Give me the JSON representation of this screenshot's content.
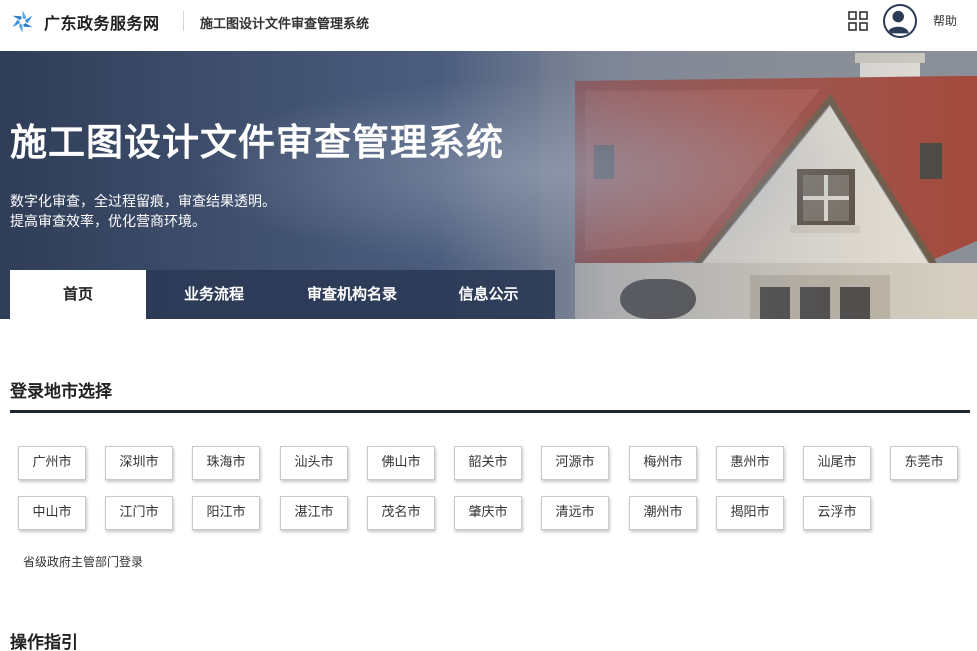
{
  "header": {
    "brand": "广东政务服务网",
    "system_name": "施工图设计文件审查管理系统",
    "help_label": "帮助",
    "icons": {
      "logo": "gd-gov-logo-icon",
      "apps": "grid-apps-icon",
      "user": "user-avatar-icon"
    }
  },
  "banner": {
    "title": "施工图设计文件审查管理系统",
    "desc_line1": "数字化审查，全过程留痕，审查结果透明。",
    "desc_line2": "提高审查效率，优化营商环境。"
  },
  "tabs": [
    {
      "label": "首页",
      "active": true
    },
    {
      "label": "业务流程",
      "active": false
    },
    {
      "label": "审查机构名录",
      "active": false
    },
    {
      "label": "信息公示",
      "active": false
    }
  ],
  "city_section": {
    "title": "登录地市选择",
    "cities": [
      "广州市",
      "深圳市",
      "珠海市",
      "汕头市",
      "佛山市",
      "韶关市",
      "河源市",
      "梅州市",
      "惠州市",
      "汕尾市",
      "东莞市",
      "中山市",
      "江门市",
      "阳江市",
      "湛江市",
      "茂名市",
      "肇庆市",
      "清远市",
      "潮州市",
      "揭阳市",
      "云浮市"
    ],
    "province_login": "省级政府主管部门登录"
  },
  "guide_section": {
    "title": "操作指引"
  },
  "colors": {
    "nav_bg": "#2b3a56",
    "rule": "#1f2530",
    "logo_blue": "#3d8fd9"
  }
}
